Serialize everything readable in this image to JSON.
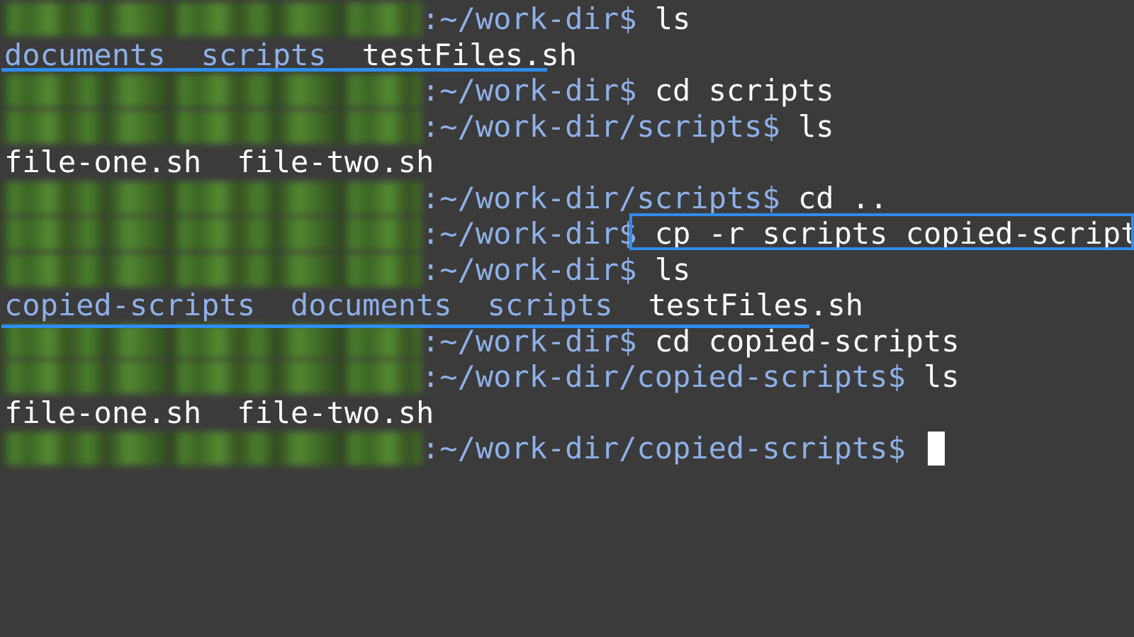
{
  "lines": [
    {
      "kind": "prompt",
      "path": ":~/work-dir$",
      "cmd": " ls"
    },
    {
      "kind": "output",
      "items": [
        {
          "text": "documents",
          "type": "dir"
        },
        {
          "text": "scripts",
          "type": "dir"
        },
        {
          "text": "testFiles.sh",
          "type": "file"
        }
      ]
    },
    {
      "kind": "prompt",
      "path": ":~/work-dir$",
      "cmd": " cd scripts"
    },
    {
      "kind": "prompt",
      "path": ":~/work-dir/scripts$",
      "cmd": " ls"
    },
    {
      "kind": "output",
      "items": [
        {
          "text": "file-one.sh",
          "type": "file"
        },
        {
          "text": "file-two.sh",
          "type": "file"
        }
      ]
    },
    {
      "kind": "prompt",
      "path": ":~/work-dir/scripts$",
      "cmd": " cd .."
    },
    {
      "kind": "prompt",
      "path": ":~/work-dir$",
      "cmd": " cp -r scripts copied-scripts"
    },
    {
      "kind": "prompt",
      "path": ":~/work-dir$",
      "cmd": " ls"
    },
    {
      "kind": "output",
      "items": [
        {
          "text": "copied-scripts",
          "type": "dir"
        },
        {
          "text": "documents",
          "type": "dir"
        },
        {
          "text": "scripts",
          "type": "dir"
        },
        {
          "text": "testFiles.sh",
          "type": "file"
        }
      ]
    },
    {
      "kind": "prompt",
      "path": ":~/work-dir$",
      "cmd": " cd copied-scripts"
    },
    {
      "kind": "prompt",
      "path": ":~/work-dir/copied-scripts$",
      "cmd": " ls"
    },
    {
      "kind": "output",
      "items": [
        {
          "text": "file-one.sh",
          "type": "file"
        },
        {
          "text": "file-two.sh",
          "type": "file"
        }
      ]
    },
    {
      "kind": "prompt",
      "path": ":~/work-dir/copied-scripts$",
      "cmd": " ",
      "cursor": true
    }
  ],
  "colors": {
    "background": "#3b3b3b",
    "path": "#8fb0e8",
    "dir": "#8fb0e8",
    "text": "#ffffff",
    "highlight": "#2f8cf0",
    "redacted_user": "#4e8a2a"
  }
}
